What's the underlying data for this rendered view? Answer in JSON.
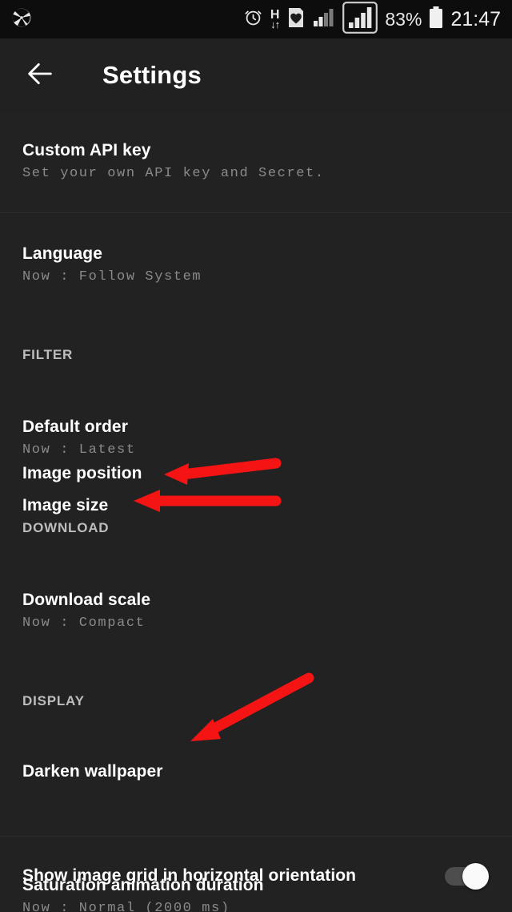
{
  "status_bar": {
    "notification_icon": "camera-aperture-icon",
    "icons": [
      "alarm-clock-icon",
      "hspa-data-icon",
      "heart-card-icon",
      "signal-bars-icon",
      "signal-bars-sim2-icon",
      "battery-icon"
    ],
    "hspa_label": "H",
    "hspa_arrows": "↓↑",
    "battery_percent": "83%",
    "time": "21:47"
  },
  "appbar": {
    "back_icon": "back-arrow-icon",
    "title": "Settings"
  },
  "settings": {
    "items": [
      {
        "title": "Custom API key",
        "subtitle": "Set your own API key and Secret."
      },
      {
        "title": "Language",
        "subtitle": "Now : Follow System"
      }
    ],
    "filter_section": {
      "header": "FILTER",
      "items": [
        {
          "title": "Default order",
          "subtitle": "Now : Latest"
        },
        {
          "title": "Image position",
          "subtitle": ""
        },
        {
          "title": "Image size",
          "subtitle": ""
        }
      ]
    },
    "download_section": {
      "header": "DOWNLOAD",
      "items": [
        {
          "title": "Download scale",
          "subtitle": "Now : Compact"
        }
      ]
    },
    "display_section": {
      "header": "DISPLAY",
      "items": [
        {
          "title": "Darken wallpaper",
          "subtitle": ""
        },
        {
          "title": "Saturation animation duration",
          "subtitle": "Now : Normal (2000 ms)"
        }
      ]
    },
    "grid_toggle": {
      "title": "Show image grid in horizontal orientation",
      "state": "on"
    }
  },
  "annotations": {
    "color": "#F41414",
    "arrows": [
      {
        "name": "arrow-image-position",
        "points_to": "Image position"
      },
      {
        "name": "arrow-image-size",
        "points_to": "Image size"
      },
      {
        "name": "arrow-darken-wallpaper",
        "points_to": "Darken wallpaper"
      }
    ]
  },
  "colors": {
    "background": "#222222",
    "appbar": "#212121",
    "statusbar": "#0d0d0d",
    "title_text": "#ffffff",
    "subtitle_text": "#8a8a8a",
    "section_text": "#bdbdbd",
    "accent_red": "#F41414"
  }
}
